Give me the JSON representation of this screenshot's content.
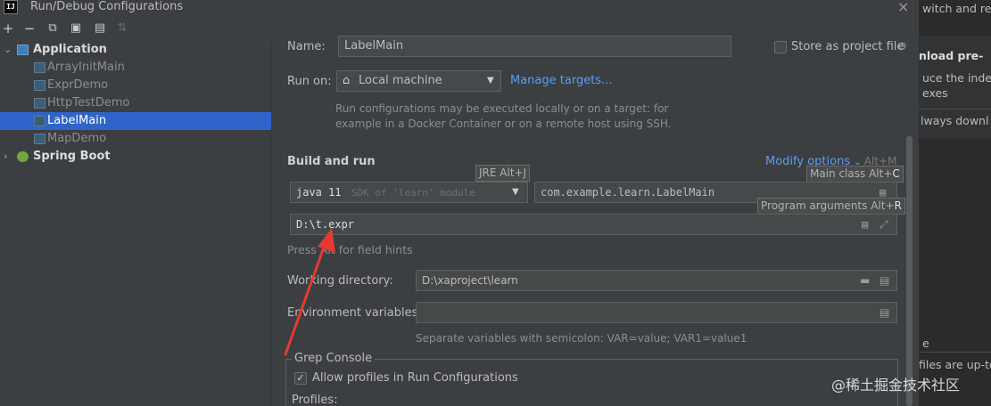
{
  "window": {
    "title": "Run/Debug Configurations",
    "app_icon_text": "IJ"
  },
  "toolbar": {
    "add": "+",
    "remove": "−",
    "copy": "⧉",
    "save": "▣",
    "folder": "▤",
    "sort": "⇅"
  },
  "tree": {
    "application": "Application",
    "items": [
      "ArrayInitMain",
      "ExprDemo",
      "HttpTestDemo",
      "LabelMain",
      "MapDemo"
    ],
    "selected": "LabelMain",
    "spring_boot": "Spring Boot"
  },
  "form": {
    "name_label": "Name:",
    "name_value": "LabelMain",
    "store_label": "Store as project file",
    "run_on_label": "Run on:",
    "run_on_value": "Local machine",
    "manage_targets": "Manage targets...",
    "run_on_hint_1": "Run configurations may be executed locally or on a target: for",
    "run_on_hint_2": "example in a Docker Container or on a remote host using SSH.",
    "build_and_run": "Build and run",
    "modify_options": "Modify options",
    "modify_shortcut": "Alt+M",
    "jre_tooltip": "JRE Alt+J",
    "jre_value": "java 11",
    "jre_hint": "SDK of 'learn' module",
    "main_class_tooltip_text": "Main class Alt+",
    "main_class_tooltip_key": "C",
    "main_class_value": "com.example.learn.LabelMain",
    "program_args_tooltip_text": "Program arguments Alt+",
    "program_args_tooltip_key": "R",
    "program_args_value": "D:\\t.expr",
    "field_hints": "Press Alt for field hints",
    "working_dir_label": "Working directory:",
    "working_dir_value": "D:\\xaproject\\learn",
    "env_label": "Environment variables:",
    "env_value": "",
    "env_hint": "Separate variables with semicolon: VAR=value; VAR1=value1",
    "grep_console": "Grep Console",
    "allow_profiles": "Allow profiles in Run Configurations",
    "allow_profiles_checked": true,
    "profiles_label": "Profiles:"
  },
  "background_window": {
    "line1": "witch and re",
    "line2": "nload pre-",
    "line3": "uce the inde",
    "line4": "exes",
    "line5": "lways downl",
    "line6": "e",
    "line7": "files are up-to"
  },
  "watermark": "@稀土掘金技术社区",
  "colors": {
    "accent": "#589df6",
    "selection": "#2f65ca",
    "arrow": "#e53935"
  }
}
